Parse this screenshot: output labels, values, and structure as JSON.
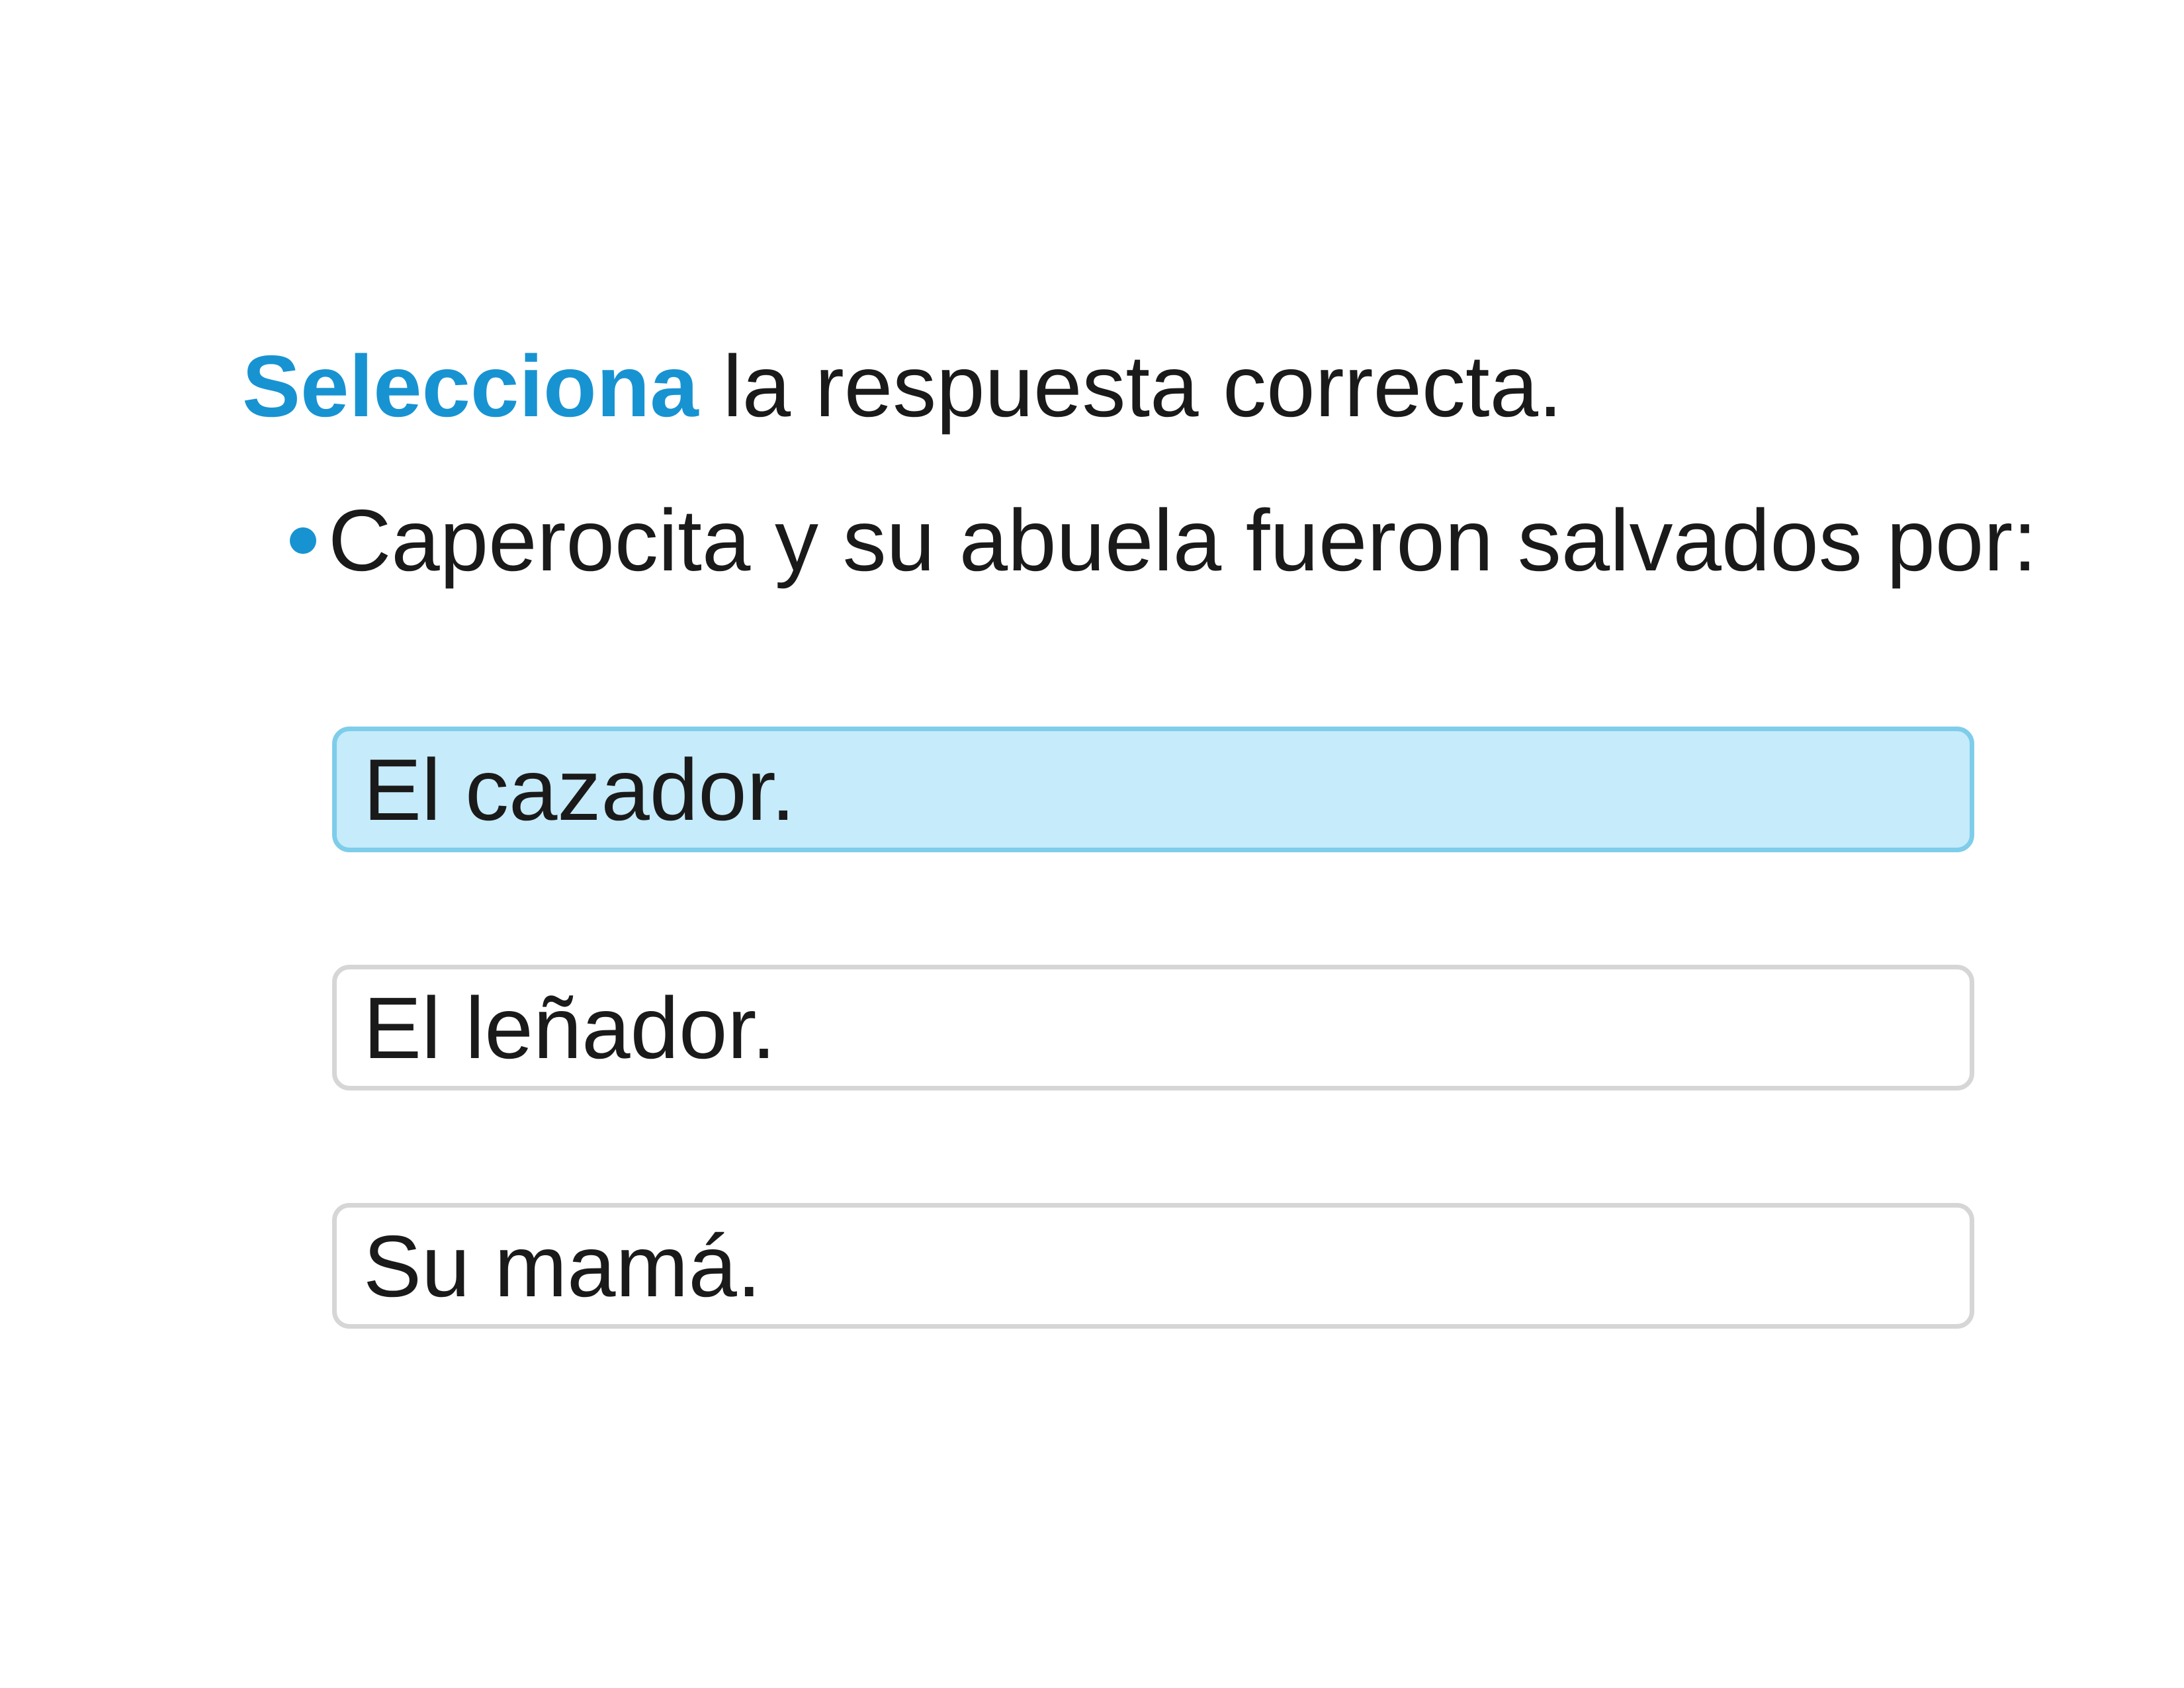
{
  "instruction": {
    "verb": "Selecciona",
    "rest": "la respuesta correcta."
  },
  "question": {
    "text": "Caperocita y su abuela fueron salvados por:"
  },
  "options": [
    {
      "label": "El cazador.",
      "selected": true
    },
    {
      "label": "El leñador.",
      "selected": false
    },
    {
      "label": "Su mamá.",
      "selected": false
    }
  ],
  "colors": {
    "accent": "#1893d2",
    "selected_fill": "#c6ebfa",
    "selected_border": "#7ecdea",
    "option_border": "#d6d6d6",
    "text": "#1a1a1a"
  }
}
